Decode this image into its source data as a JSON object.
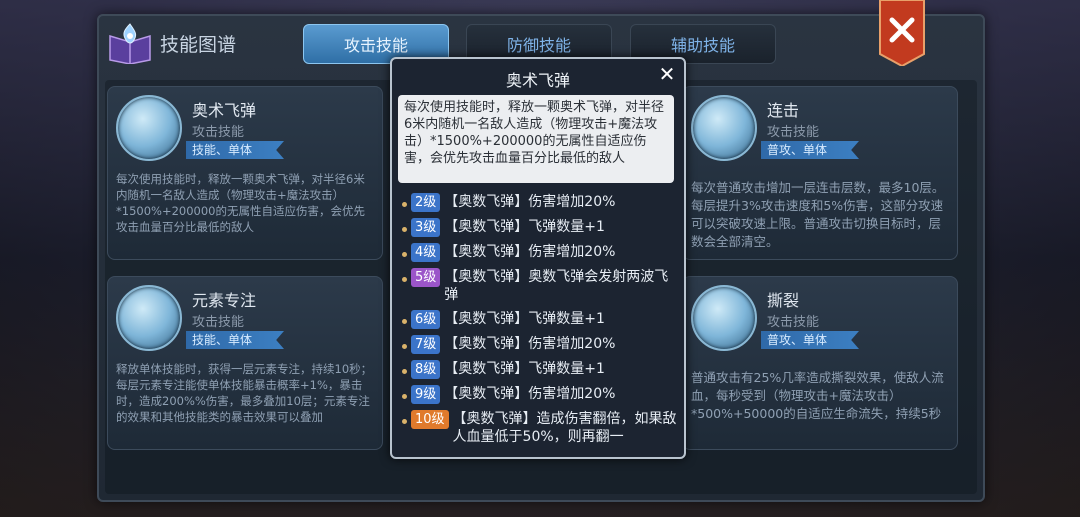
{
  "header": {
    "title": "技能图谱",
    "tabs": [
      {
        "label": "攻击技能",
        "active": true
      },
      {
        "label": "防御技能",
        "active": false
      },
      {
        "label": "辅助技能",
        "active": false
      }
    ]
  },
  "cards": [
    {
      "name": "奥术飞弹",
      "type": "攻击技能",
      "tag": "技能、单体",
      "desc": "每次使用技能时，释放一颗奥术飞弹，对半径6米内随机一名敌人造成（物理攻击+魔法攻击）*1500%+200000的无属性自适应伤害，会优先攻击血量百分比最低的敌人"
    },
    {
      "name": "元素专注",
      "type": "攻击技能",
      "tag": "技能、单体",
      "desc": "释放单体技能时，获得一层元素专注，持续10秒；每层元素专注能使单体技能暴击概率+1%，暴击时，造成200%%伤害，最多叠加10层；元素专注的效果和其他技能类的暴击效果可以叠加"
    },
    {
      "name": "连击",
      "type": "攻击技能",
      "tag": "普攻、单体",
      "desc": "每次普通攻击增加一层连击层数，最多10层。每层提升3%攻击速度和5%伤害，这部分攻速可以突破攻速上限。普通攻击切换目标时，层数会全部清空。"
    },
    {
      "name": "撕裂",
      "type": "攻击技能",
      "tag": "普攻、单体",
      "desc": "普通攻击有25%几率造成撕裂效果，使敌人流血，每秒受到（物理攻击+魔法攻击）*500%+50000的自适应生命流失，持续5秒"
    }
  ],
  "popup": {
    "title": "奥术飞弹",
    "close": "✕",
    "desc": "每次使用技能时，释放一颗奥术飞弹，对半径6米内随机一名敌人造成（物理攻击+魔法攻击）*1500%+200000的无属性自适应伤害，会优先攻击血量百分比最低的敌人",
    "levels": [
      {
        "level": "2级",
        "color": "#3b74c9",
        "text": "【奥数飞弹】伤害增加20%"
      },
      {
        "level": "3级",
        "color": "#3b74c9",
        "text": "【奥数飞弹】飞弹数量+1"
      },
      {
        "level": "4级",
        "color": "#3b74c9",
        "text": "【奥数飞弹】伤害增加20%"
      },
      {
        "level": "5级",
        "color": "#9b55c9",
        "text": "【奥数飞弹】奥数飞弹会发射两波飞弹"
      },
      {
        "level": "6级",
        "color": "#3b74c9",
        "text": "【奥数飞弹】飞弹数量+1"
      },
      {
        "level": "7级",
        "color": "#3b74c9",
        "text": "【奥数飞弹】伤害增加20%"
      },
      {
        "level": "8级",
        "color": "#3b74c9",
        "text": "【奥数飞弹】飞弹数量+1"
      },
      {
        "level": "9级",
        "color": "#3b74c9",
        "text": "【奥数飞弹】伤害增加20%"
      },
      {
        "level": "10级",
        "color": "#e07a2c",
        "text": "【奥数飞弹】造成伤害翻倍，如果敌人血量低于50%，则再翻一"
      }
    ]
  },
  "icons": {
    "book": "spellbook-icon",
    "close_main": "close-icon",
    "skill_icons": [
      "arcane-missile-icon",
      "element-focus-icon",
      "combo-arrow-icon",
      "tear-claw-icon"
    ]
  }
}
